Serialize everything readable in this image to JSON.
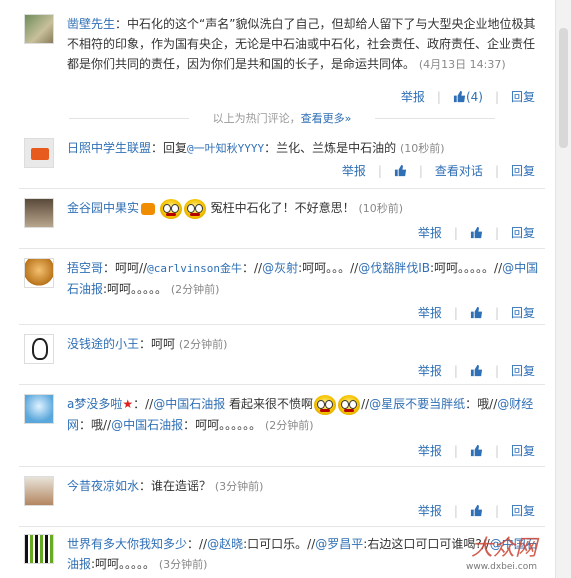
{
  "comments": [
    {
      "user": "凿壁先生",
      "text": "中石化的这个“声名”貌似洗白了自己，但却给人留下了与大型央企业地位极其不相符的印象，作为国有央企，无论是中石油或中石化，社会责任、政府责任、企业责任都是你们共同的责任，因为你们是共和国的长子，是命运共同体。",
      "time": "(4月13日 14:37)",
      "actions": {
        "report": "举报",
        "likes": "(4)",
        "reply": "回复"
      }
    },
    {
      "user": "日照中学生联盟",
      "prefix": "：回复",
      "mention": "@一叶知秋YYYY",
      "text": "：兰化、兰炼是中石油的",
      "time": "(10秒前)",
      "actions": {
        "report": "举报",
        "view": "查看对话",
        "reply": "回复"
      }
    },
    {
      "user": "金谷园中果实",
      "text": "冤枉中石化了！不好意思！",
      "time": "(10秒前)",
      "actions": {
        "report": "举报",
        "reply": "回复"
      }
    },
    {
      "user": "捂空哥",
      "text1": "：呵呵//",
      "m1": "@carlvinson金牛",
      "t2": "：//",
      "m2": "@灰射",
      "t3": ":呵呵。。。//",
      "m3": "@伐豁胖伐IB",
      "t4": ":呵呵。。。。。//",
      "m4": "@中国石油报",
      "t5": ":呵呵。。。。。",
      "time": "(2分钟前)",
      "actions": {
        "report": "举报",
        "reply": "回复"
      }
    },
    {
      "user": "没钱途的小王",
      "text": "：呵呵",
      "time": "(2分钟前)",
      "actions": {
        "report": "举报",
        "reply": "回复"
      }
    },
    {
      "user": "a梦没多啦",
      "t1": "：//",
      "m1": "@中国石油报",
      "t2": " 看起来很不愤啊",
      "t3": "//",
      "m2": "@星辰不要当胖纸",
      "t4": "：哦//",
      "m3": "@财经网",
      "t5": "：哦//",
      "m4": "@中国石油报",
      "t6": "：呵呵。。。。。。",
      "time": "(2分钟前)",
      "actions": {
        "report": "举报",
        "reply": "回复"
      }
    },
    {
      "user": "今昔夜凉如水",
      "text": "：谁在造谣？",
      "time": "(3分钟前)",
      "actions": {
        "report": "举报",
        "reply": "回复"
      }
    },
    {
      "user": "世界有多大你我知多少",
      "t1": "：//",
      "m1": "@赵晓",
      "t2": ":口可口乐。//",
      "m2": "@罗昌平",
      "t3": ":右边这口可口可谁喝?//",
      "m3": "@中国石油报",
      "t4": ":呵呵。。。。。",
      "time": "(3分钟前)"
    }
  ],
  "hot_divider": {
    "label": "以上为热门评论，",
    "more": "查看更多»"
  },
  "watermark": {
    "site": "大众网",
    "url": "www.dxbei.com"
  },
  "colors": {
    "link": "#2f6fb5",
    "text": "#333333",
    "muted": "#888888"
  }
}
